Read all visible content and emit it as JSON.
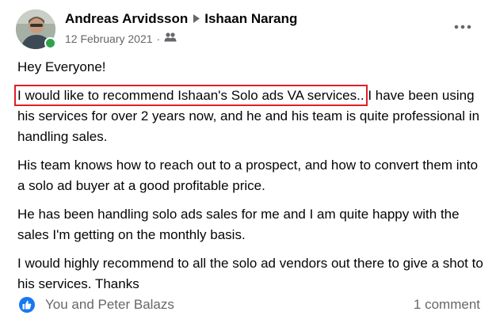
{
  "post": {
    "author": "Andreas Arvidsson",
    "recipient": "Ishaan Narang",
    "date": "12 February 2021",
    "separator": "·",
    "privacy_icon": "group-icon",
    "more_icon": "more-options-icon",
    "paragraphs": {
      "p1": "Hey Everyone!",
      "p2_highlight": "I would like to recommend Ishaan's Solo ads VA services..",
      "p2_rest": " I have been using his services for over 2 years now, and he and his team is quite professional in handling sales.",
      "p3": "His team knows how to reach out to a prospect, and how to convert them into a solo ad buyer at a good profitable price.",
      "p4": "He has been handling solo ads sales for me and I am quite happy with the sales I'm getting on the monthly basis.",
      "p5": "I would highly recommend to all the solo ad vendors out there to give a shot to his services. Thanks"
    },
    "highlight_color": "#e01e25"
  },
  "footer": {
    "reactions_text": "You and Peter Balazs",
    "reaction_icon": "like-icon",
    "comments": "1 comment"
  }
}
